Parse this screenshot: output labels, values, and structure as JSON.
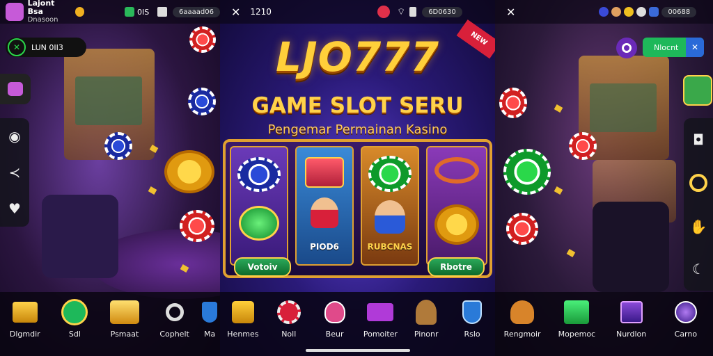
{
  "left": {
    "profile_name": "Lajont Bsa",
    "profile_sub": "Dnasoon",
    "status_level": "0IS",
    "status_pill": "6aaaad06",
    "promo_pill": "LUN 0II3",
    "bottom_nav": [
      {
        "label": "Dlgmdir",
        "icon": "gold-bars-icon"
      },
      {
        "label": "Sdl",
        "icon": "green-coin-icon"
      },
      {
        "label": "Psmaat",
        "icon": "gold-stack-icon"
      },
      {
        "label": "Cophelt",
        "icon": "magnifier-icon"
      },
      {
        "label": "Ma",
        "icon": "shield-icon"
      }
    ],
    "rail_icons": [
      "eye-icon",
      "share-icon",
      "heart-icon"
    ]
  },
  "center": {
    "close_glyph": "✕",
    "time": "1210",
    "status_pill": "6D0630",
    "brand": "LJO777",
    "subtitle": "GAME SLOT SERU",
    "tagline": "Pengemar Permainan Kasino",
    "ribbon": "NEW",
    "reels": [
      {
        "label": "",
        "button": "Votoiv"
      },
      {
        "label": "PIOD6",
        "button": ""
      },
      {
        "label": "RUBCNAS",
        "button": ""
      },
      {
        "label": "",
        "button": "Rbotre"
      }
    ],
    "bottom_nav": [
      {
        "label": "Henmes",
        "icon": "gift-box-icon"
      },
      {
        "label": "Noll",
        "icon": "wheel-icon"
      },
      {
        "label": "Beur",
        "icon": "heart-badge-icon"
      },
      {
        "label": "Pomoiter",
        "icon": "ticket-icon"
      },
      {
        "label": "Pinonr",
        "icon": "monkey-icon"
      },
      {
        "label": "Rslo",
        "icon": "shield-icon"
      }
    ]
  },
  "right": {
    "close_glyph": "✕",
    "status_pill": "00688",
    "top_pill": "Nlocnt",
    "bottom_nav": [
      {
        "label": "Rengmoir",
        "icon": "squirrel-icon"
      },
      {
        "label": "Mopemoc",
        "icon": "green-box-icon"
      },
      {
        "label": "Nurdlon",
        "icon": "cube-icon"
      },
      {
        "label": "Carno",
        "icon": "orb-icon"
      }
    ],
    "rail_icons": [
      "camera-icon",
      "ring-icon",
      "hand-icon",
      "moon-icon"
    ]
  },
  "colors": {
    "accent_gold": "#ffcf3a",
    "accent_green": "#1eb85a",
    "accent_purple": "#5a3fd0"
  }
}
